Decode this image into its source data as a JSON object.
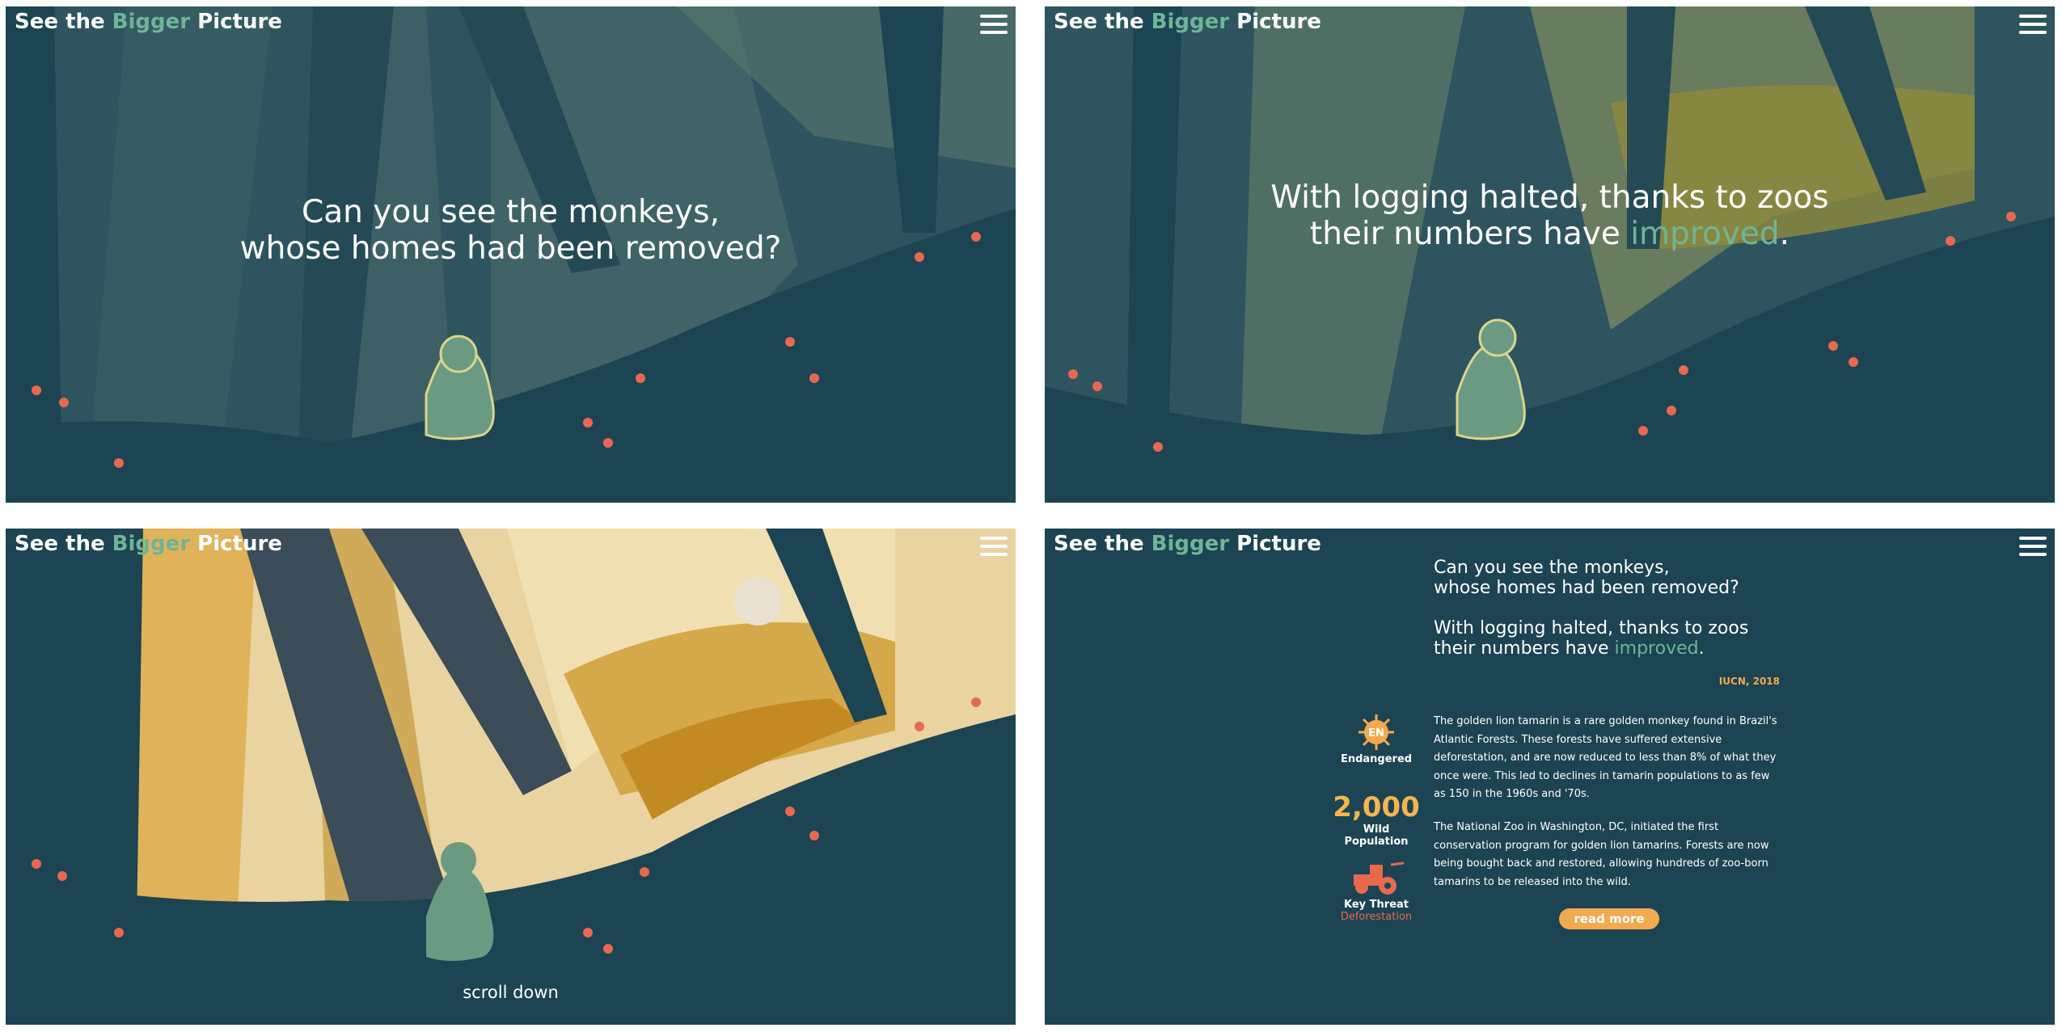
{
  "brand": {
    "prefix": "See the ",
    "highlight": "Bigger",
    "suffix": " Picture"
  },
  "menu_icon": "hamburger-menu-icon",
  "panels": {
    "p1": {
      "line1": "Can you see the monkeys,",
      "line2": "whose homes had been removed?"
    },
    "p2": {
      "line1": "With logging halted, thanks to zoos",
      "line2_pre": "their numbers have ",
      "line2_hl": "improved",
      "line2_post": "."
    },
    "p3": {
      "scroll": "scroll down"
    },
    "p4": {
      "q1": "Can you see the monkeys,",
      "q2": "whose homes had been removed?",
      "a1": "With logging halted, thanks to zoos",
      "a2_pre": "their numbers have ",
      "a2_hl": "improved",
      "a2_post": ".",
      "source": "IUCN, 2018",
      "status_badge": "EN",
      "status_label": "Endangered",
      "population": "2,000",
      "population_label": "Wild Population",
      "threat_label": "Key Threat",
      "threat_value": "Deforestation",
      "paragraph1": "The golden lion tamarin is a rare golden monkey found in Brazil's Atlantic Forests. These forests have suffered extensive deforestation, and are now reduced to less than 8% of what they once were. This led to declines in tamarin populations to as few as 150 in the 1960s and '70s.",
      "paragraph2": "The National Zoo in Washington, DC, initiated the first conservation program for golden lion tamarins. Forests are now being bought back and restored, allowing hundreds of zoo-born tamarins to be released into the wild.",
      "read_more": "read more"
    }
  },
  "colors": {
    "dark": "#1c4452",
    "green": "#6fb596",
    "orange": "#f4a94f",
    "red": "#e8694e",
    "gold": "#e0b25a"
  }
}
